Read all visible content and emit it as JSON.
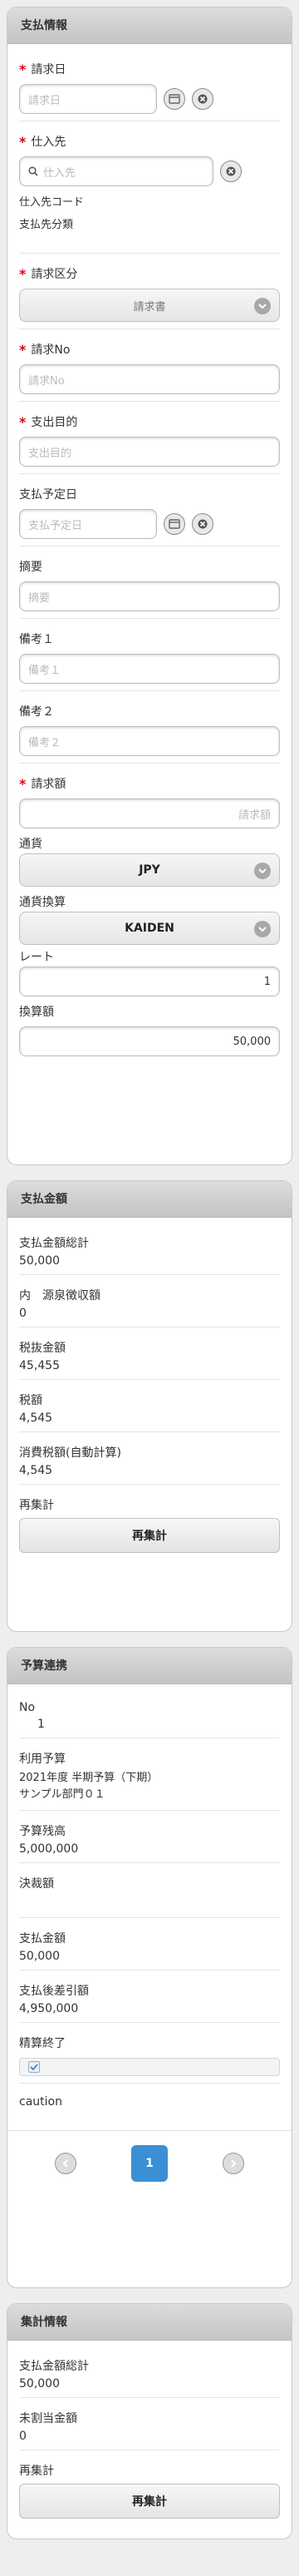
{
  "payment_info": {
    "title": "支払情報",
    "invoice_date": {
      "label": "請求日",
      "placeholder": "請求日"
    },
    "supplier": {
      "label": "仕入先",
      "placeholder": "仕入先",
      "code_label": "仕入先コード",
      "class_label": "支払先分類"
    },
    "invoice_type": {
      "label": "請求区分",
      "value": "請求書"
    },
    "invoice_no": {
      "label": "請求No",
      "placeholder": "請求No"
    },
    "purpose": {
      "label": "支出目的",
      "placeholder": "支出目的"
    },
    "due_date": {
      "label": "支払予定日",
      "placeholder": "支払予定日"
    },
    "summary": {
      "label": "摘要",
      "placeholder": "摘要"
    },
    "note1": {
      "label": "備考１",
      "placeholder": "備考１"
    },
    "note2": {
      "label": "備考２",
      "placeholder": "備考２"
    },
    "invoice_amount": {
      "label": "請求額",
      "placeholder": "請求額"
    },
    "currency": {
      "label": "通貨",
      "value": "JPY"
    },
    "conversion": {
      "label": "通貨換算",
      "value": "KAIDEN"
    },
    "rate": {
      "label": "レート",
      "value": "1"
    },
    "converted": {
      "label": "換算額",
      "value": "50,000"
    }
  },
  "payment_amount": {
    "title": "支払金額",
    "total": {
      "label": "支払金額総計",
      "value": "50,000"
    },
    "withholding": {
      "label": "内　源泉徴収額",
      "value": "0"
    },
    "pretax": {
      "label": "税抜金額",
      "value": "45,455"
    },
    "tax": {
      "label": "税額",
      "value": "4,545"
    },
    "consumption_tax": {
      "label": "消費税額(自動計算)",
      "value": "4,545"
    },
    "recalc": {
      "label": "再集計",
      "button": "再集計"
    }
  },
  "budget": {
    "title": "予算連携",
    "no": {
      "label": "No",
      "value": "1"
    },
    "used": {
      "label": "利用予算",
      "line1": "2021年度 半期予算（下期）",
      "line2": "サンプル部門０１"
    },
    "remaining": {
      "label": "予算残高",
      "value": "5,000,000"
    },
    "approved": {
      "label": "決裁額",
      "value": ""
    },
    "paid": {
      "label": "支払金額",
      "value": "50,000"
    },
    "after": {
      "label": "支払後差引額",
      "value": "4,950,000"
    },
    "settled": {
      "label": "精算終了",
      "checked": true
    },
    "caution": {
      "label": "caution"
    },
    "pager": {
      "current": "1"
    }
  },
  "summary_info": {
    "title": "集計情報",
    "total": {
      "label": "支払金額総計",
      "value": "50,000"
    },
    "unassigned": {
      "label": "未割当金額",
      "value": "0"
    },
    "recalc": {
      "label": "再集計",
      "button": "再集計"
    }
  }
}
